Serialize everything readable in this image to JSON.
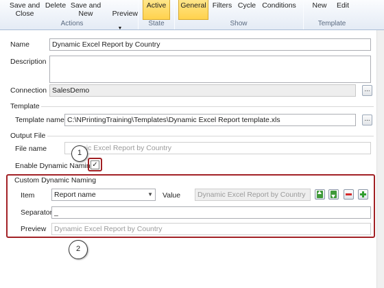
{
  "ribbon": {
    "actions": {
      "save_close": "Save and\nClose",
      "delete": "Delete",
      "save_new": "Save and\nNew",
      "preview": "Preview",
      "group": "Actions"
    },
    "state": {
      "active": "Active",
      "group": "State"
    },
    "show": {
      "general": "General",
      "filters": "Filters",
      "cycle": "Cycle",
      "conditions": "Conditions",
      "group": "Show"
    },
    "template": {
      "new": "New",
      "edit": "Edit",
      "group": "Template"
    }
  },
  "form": {
    "name_label": "Name",
    "name_value": "Dynamic Excel Report by Country",
    "description_label": "Description",
    "description_value": "",
    "connection_label": "Connection",
    "connection_value": "SalesDemo",
    "template_section": "Template",
    "template_name_label": "Template name",
    "template_name_value": "C:\\NPrintingTraining\\Templates\\Dynamic Excel Report template.xls",
    "output_section": "Output File",
    "file_name_label": "File name",
    "file_name_value": "mic Excel Report by Country",
    "enable_dynamic_label": "Enable Dynamic Naming",
    "enable_dynamic_checked": true,
    "browse_label": "...",
    "custom": {
      "title": "Custom Dynamic Naming",
      "item_label": "Item",
      "item_value": "Report name",
      "value_label": "Value",
      "value_value": "Dynamic Excel Report by Country",
      "separator_label": "Separator",
      "separator_value": "_",
      "preview_label": "Preview",
      "preview_value": "Dynamic Excel Report by Country"
    }
  },
  "callouts": {
    "one": "1",
    "two": "2"
  },
  "colors": {
    "highlight_red": "#a12024",
    "ribbon_active": "#ffd24d"
  },
  "icons": [
    "move-up-icon",
    "move-down-icon",
    "remove-icon",
    "add-icon",
    "dropdown-arrow-icon",
    "checkmark-icon"
  ]
}
